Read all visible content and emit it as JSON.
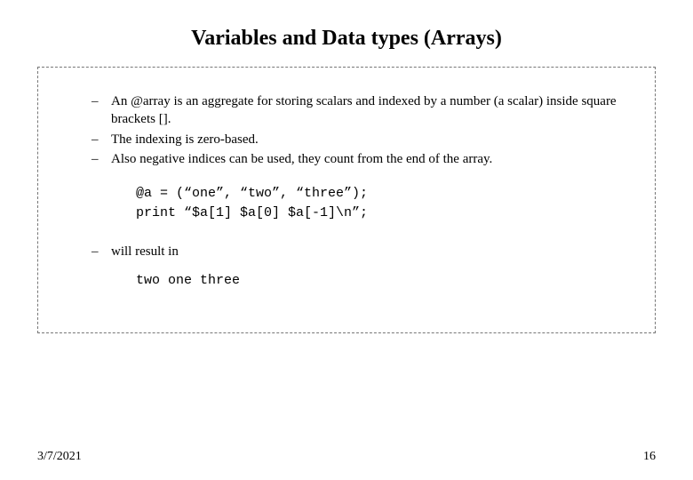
{
  "title": "Variables and Data types (Arrays)",
  "bullets": {
    "b1": "An @array is an aggregate for storing scalars and indexed by a number (a scalar) inside square brackets [].",
    "b2": "The indexing is zero-based.",
    "b3": "Also negative indices can be used, they count from the end of the array."
  },
  "code": "@a = (“one”, “two”, “three”);\nprint “$a[1] $a[0] $a[-1]\\n”;",
  "bullet4": "will result in",
  "output": "two one three",
  "footer": {
    "date": "3/7/2021",
    "pagenum": "16"
  }
}
